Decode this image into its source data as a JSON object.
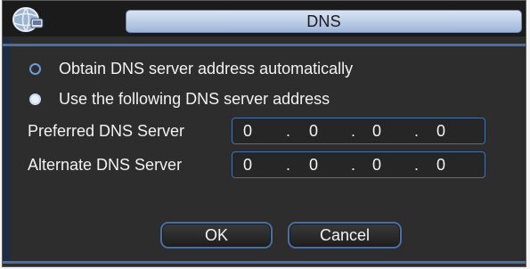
{
  "window": {
    "title": "DNS",
    "icon": "network-globe-icon"
  },
  "options": [
    {
      "label": "Obtain DNS server address automatically",
      "selected": false
    },
    {
      "label": "Use the following DNS server address",
      "selected": true
    }
  ],
  "preferred": {
    "label": "Preferred DNS Server",
    "octets": [
      "0",
      "0",
      "0",
      "0"
    ]
  },
  "alternate": {
    "label": "Alternate DNS Server",
    "octets": [
      "0",
      "0",
      "0",
      "0"
    ]
  },
  "buttons": {
    "ok": "OK",
    "cancel": "Cancel"
  },
  "colors": {
    "accent": "#4a6fa5",
    "title_bg": "#b9cbe6",
    "panel_bg": "#2d2d2d"
  }
}
